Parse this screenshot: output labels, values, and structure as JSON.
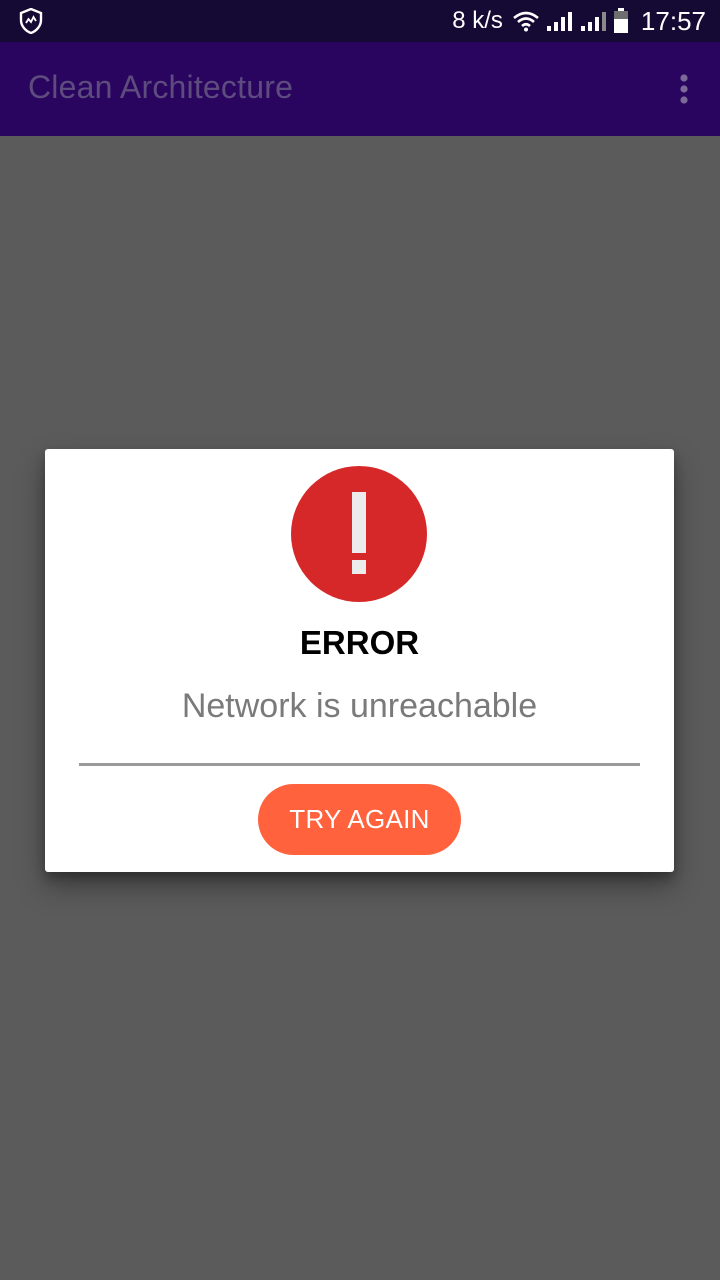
{
  "status_bar": {
    "network_speed": "8 k/s",
    "time": "17:57",
    "icons": [
      "shield-icon",
      "wifi-icon",
      "signal-icon",
      "signal-icon",
      "battery-icon"
    ]
  },
  "app_bar": {
    "title": "Clean Architecture",
    "menu_icon": "more-vert-icon"
  },
  "dialog": {
    "icon": "error-icon",
    "title": "ERROR",
    "message": "Network is unreachable",
    "retry_label": "TRY AGAIN"
  },
  "colors": {
    "status_bar": "#140a33",
    "app_bar": "#2a0560",
    "scrim": "#5b5b5b",
    "error_red": "#d62828",
    "button": "#ff623d"
  }
}
